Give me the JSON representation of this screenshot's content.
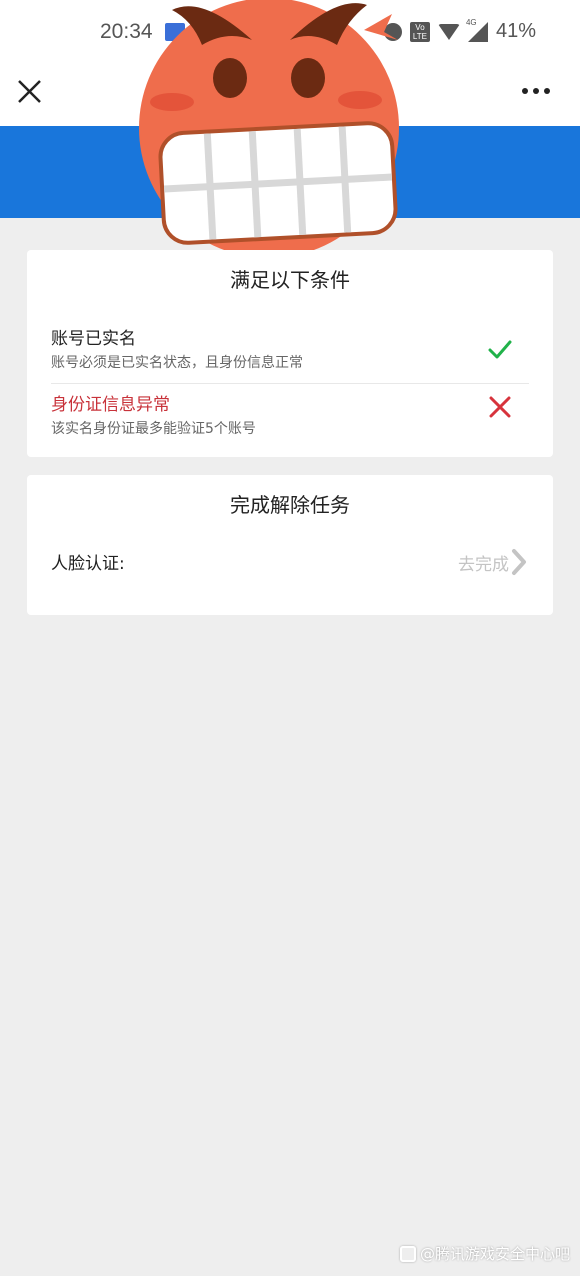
{
  "status_bar": {
    "time": "20:34",
    "volte_label": "Vo LTE",
    "network_label": "4G",
    "battery": "41%",
    "icons": [
      "mail-icon",
      "sync-icon",
      "volte-icon",
      "wifi-icon",
      "signal-icon"
    ]
  },
  "nav": {
    "close_icon": "close-icon",
    "more_icon": "more-icon"
  },
  "colors": {
    "header_blue": "#1976db",
    "success_green": "#21b24a",
    "error_red": "#d7333c",
    "page_bg": "#eeeeee"
  },
  "conditions_card": {
    "title": "满足以下条件",
    "items": [
      {
        "title": "账号已实名",
        "desc": "账号必须是已实名状态，且身份信息正常",
        "status": "passed",
        "status_icon": "check-icon"
      },
      {
        "title": "身份证信息异常",
        "desc": "该实名身份证最多能验证5个账号",
        "status": "failed",
        "status_icon": "cross-icon"
      }
    ]
  },
  "tasks_card": {
    "title": "完成解除任务",
    "items": [
      {
        "label": "人脸认证:",
        "action": "去完成",
        "action_icon": "chevron-right-icon"
      }
    ]
  },
  "overlay": {
    "icon": "grimace-emoji-icon"
  },
  "watermark": {
    "text": "@腾讯游戏安全中心吧"
  }
}
